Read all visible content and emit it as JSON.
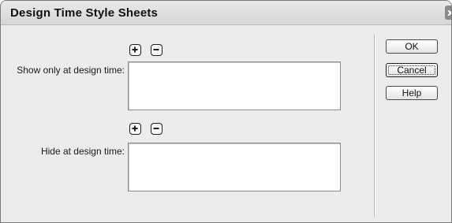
{
  "window": {
    "title": "Design Time Style Sheets",
    "close_glyph": "x"
  },
  "show_section": {
    "label": "Show only at design time:",
    "add_icon": "plus-icon",
    "remove_icon": "minus-icon",
    "items": []
  },
  "hide_section": {
    "label": "Hide at design time:",
    "add_icon": "plus-icon",
    "remove_icon": "minus-icon",
    "items": []
  },
  "buttons": {
    "ok": "OK",
    "cancel": "Cancel",
    "help": "Help"
  },
  "colors": {
    "dialog_bg": "#ececec",
    "listbox_bg": "#ffffff"
  }
}
